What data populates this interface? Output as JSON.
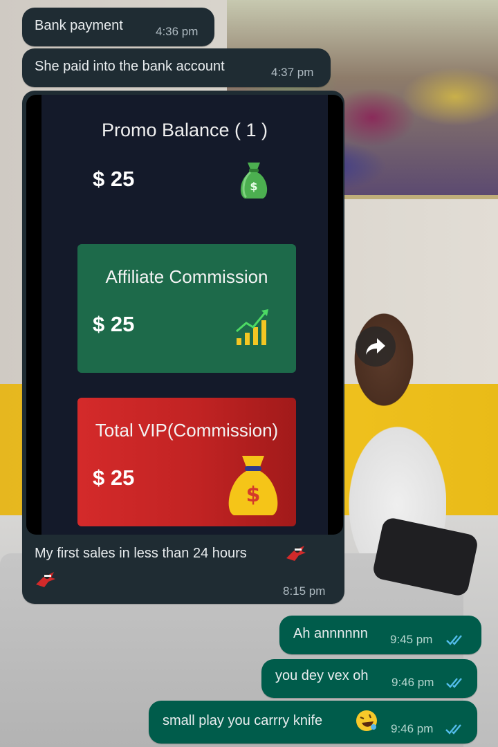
{
  "messages": [
    {
      "text": "Bank payment",
      "time": "4:36 pm"
    },
    {
      "text": "She paid into the bank account",
      "time": "4:37 pm"
    },
    {
      "image": {
        "promo_title": "Promo Balance ( 1 )",
        "promo_amount": "$ 25",
        "affiliate_title": "Affiliate Commission",
        "affiliate_amount": "$ 25",
        "vip_title": "Total VIP(Commission)",
        "vip_amount": "$ 25",
        "icons": [
          "money-bag-icon",
          "growth-chart-icon",
          "money-sack-icon"
        ]
      },
      "caption": "My first sales in less than 24 hours",
      "time": "8:15 pm"
    },
    {
      "text": "Ah annnnnn",
      "time": "9:45 pm"
    },
    {
      "text": "you dey vex oh",
      "time": "9:46 pm"
    },
    {
      "text": "small play you carrry knife",
      "time": "9:46 pm"
    }
  ],
  "icons": {
    "forward": "forward-arrow-icon",
    "read_receipt": "double-check-icon",
    "emoji_runner": "ninja-emoji-icon",
    "emoji_laugh": "rolling-laughing-emoji-icon"
  },
  "colors": {
    "incoming_bubble": "#1f2c33",
    "outgoing_bubble": "#005c4b",
    "read_tick": "#53bdeb",
    "green_card": "#1d6a4a",
    "red_card": "#c12323"
  }
}
